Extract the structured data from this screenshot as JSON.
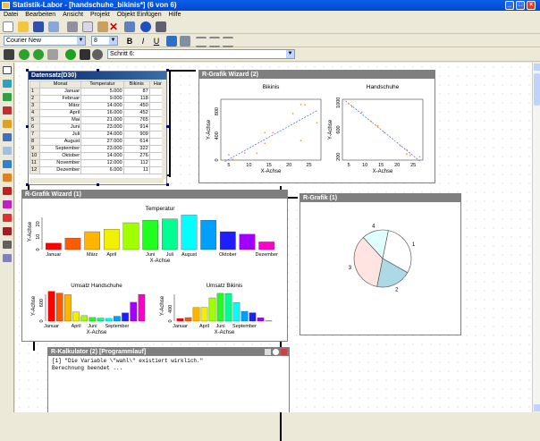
{
  "window": {
    "title": "Statistik-Labor - [handschuhe_bikinis*] (6 von 6)",
    "min": "_",
    "max": "□",
    "close": "×"
  },
  "menu": [
    "Datei",
    "Bearbeiten",
    "Ansicht",
    "Projekt",
    "Objekt Einfügen",
    "Hilfe"
  ],
  "format": {
    "font": "Courier New",
    "size": "8",
    "bold": "B",
    "italic": "I",
    "underline": "U"
  },
  "step": {
    "label": "Schritt 6:"
  },
  "table_window": {
    "title": "Datensatz(D30)",
    "headers": [
      "",
      "Monat",
      "Temperatur",
      "Bikinis",
      "Har"
    ],
    "rows": [
      [
        "1",
        "Januar",
        "5.000",
        "87"
      ],
      [
        "2",
        "Februar",
        "9.000",
        "118"
      ],
      [
        "3",
        "März",
        "14.000",
        "450"
      ],
      [
        "4",
        "April",
        "16.000",
        "452"
      ],
      [
        "5",
        "Mai",
        "21.000",
        "765"
      ],
      [
        "6",
        "Juni",
        "23.000",
        "914"
      ],
      [
        "7",
        "Juli",
        "24.000",
        "909"
      ],
      [
        "8",
        "August",
        "27.000",
        "614"
      ],
      [
        "9",
        "September",
        "23.000",
        "322"
      ],
      [
        "10",
        "Oktober",
        "14.000",
        "276"
      ],
      [
        "11",
        "November",
        "12.000",
        "112"
      ],
      [
        "12",
        "Dezember",
        "6.000",
        "11"
      ]
    ]
  },
  "scatter_window": {
    "title": "R-Grafik Wizard (2)"
  },
  "bar_window": {
    "title": "R-Grafik Wizard (1)"
  },
  "pie_window": {
    "title": "R-Grafik (1)"
  },
  "console_window": {
    "title": "R-Kalkulator (2) [Programmlauf]",
    "text": "[1] \"Die Variable \\\"wahl\\\" existiert wirklich.\"\nBerechnung beendet ..."
  },
  "chart_data": [
    {
      "type": "scatter",
      "title": "Bikinis",
      "xlabel": "X-Achse",
      "ylabel": "Y-Achse",
      "xlim": [
        3,
        28
      ],
      "ylim": [
        0,
        1000
      ],
      "xticks": [
        "5",
        "10",
        "15",
        "20",
        "25"
      ],
      "yticks": [
        "0",
        "400",
        "800"
      ],
      "trend": "increasing",
      "points": [
        [
          5,
          87
        ],
        [
          9,
          118
        ],
        [
          14,
          450
        ],
        [
          16,
          452
        ],
        [
          21,
          765
        ],
        [
          23,
          914
        ],
        [
          24,
          909
        ],
        [
          27,
          614
        ],
        [
          23,
          322
        ],
        [
          14,
          276
        ],
        [
          12,
          112
        ],
        [
          6,
          11
        ]
      ]
    },
    {
      "type": "scatter",
      "title": "Handschuhe",
      "xlabel": "X-Achse",
      "ylabel": "Y-Achse",
      "xlim": [
        3,
        28
      ],
      "ylim": [
        150,
        1050
      ],
      "xticks": [
        "5",
        "10",
        "15",
        "20",
        "25"
      ],
      "yticks": [
        "200",
        "600",
        "1000"
      ],
      "trend": "decreasing",
      "points": [
        [
          5,
          980
        ],
        [
          9,
          860
        ],
        [
          14,
          640
        ],
        [
          16,
          560
        ],
        [
          21,
          360
        ],
        [
          23,
          240
        ],
        [
          24,
          220
        ],
        [
          27,
          200
        ],
        [
          23,
          300
        ],
        [
          14,
          660
        ],
        [
          12,
          720
        ],
        [
          6,
          940
        ]
      ]
    },
    {
      "type": "bar",
      "title": "Temperatur",
      "xlabel": "X-Achse",
      "ylabel": "Y-Achse",
      "ylim": [
        0,
        28
      ],
      "yticks": [
        "0",
        "10",
        "20"
      ],
      "categories": [
        "Januar",
        "Februar",
        "März",
        "April",
        "Mai",
        "Juni",
        "Juli",
        "August",
        "September",
        "Oktober",
        "November",
        "Dezember"
      ],
      "xticklabels": [
        "Januar",
        "März",
        "April",
        "Juni",
        "Juli",
        "August",
        "Oktober",
        "Dezember"
      ],
      "values": [
        5,
        9,
        14,
        16,
        21,
        23,
        24,
        27,
        23,
        14,
        12,
        6
      ],
      "colors": [
        "#ff0000",
        "#ff5a00",
        "#ffb400",
        "#f0f000",
        "#a0ff00",
        "#20ff20",
        "#00ff90",
        "#00ffff",
        "#00a0ff",
        "#1e1eff",
        "#a000ff",
        "#ff00c8"
      ]
    },
    {
      "type": "bar",
      "title": "Umsatz Handschuhe",
      "xlabel": "X-Achse",
      "ylabel": "Y-Achse",
      "ylim": [
        0,
        1000
      ],
      "yticks": [
        "0",
        "600"
      ],
      "categories": [
        "Januar",
        "Februar",
        "März",
        "April",
        "Mai",
        "Juni",
        "Juli",
        "August",
        "September",
        "Oktober",
        "November",
        "Dezember"
      ],
      "xticklabels": [
        "Januar",
        "April",
        "Juni",
        "September"
      ],
      "values": [
        980,
        920,
        870,
        300,
        180,
        120,
        100,
        90,
        160,
        270,
        620,
        880
      ],
      "colors": [
        "#ff0000",
        "#ff5a00",
        "#ffb400",
        "#f0f000",
        "#a0ff00",
        "#20ff20",
        "#00ff90",
        "#00ffff",
        "#00a0ff",
        "#1e1eff",
        "#a000ff",
        "#ff00c8"
      ]
    },
    {
      "type": "bar",
      "title": "Umsatz Bikinis",
      "xlabel": "X-Achse",
      "ylabel": "Y-Achse",
      "ylim": [
        0,
        1000
      ],
      "yticks": [
        "0",
        "400"
      ],
      "categories": [
        "Januar",
        "Februar",
        "März",
        "April",
        "Mai",
        "Juni",
        "Juli",
        "August",
        "September",
        "Oktober",
        "November",
        "Dezember"
      ],
      "xticklabels": [
        "Januar",
        "April",
        "Juni",
        "September"
      ],
      "values": [
        87,
        118,
        450,
        452,
        765,
        914,
        909,
        614,
        322,
        276,
        112,
        11
      ],
      "colors": [
        "#ff0000",
        "#ff5a00",
        "#ffb400",
        "#f0f000",
        "#a0ff00",
        "#20ff20",
        "#00ff90",
        "#00ffff",
        "#00a0ff",
        "#1e1eff",
        "#a000ff",
        "#ff00c8"
      ]
    },
    {
      "type": "pie",
      "labels": [
        "1",
        "2",
        "3",
        "4"
      ],
      "values": [
        30,
        20,
        35,
        15
      ],
      "colors": [
        "#ffffff",
        "#add8e6",
        "#ffe4e1",
        "#e0ffff"
      ]
    }
  ]
}
